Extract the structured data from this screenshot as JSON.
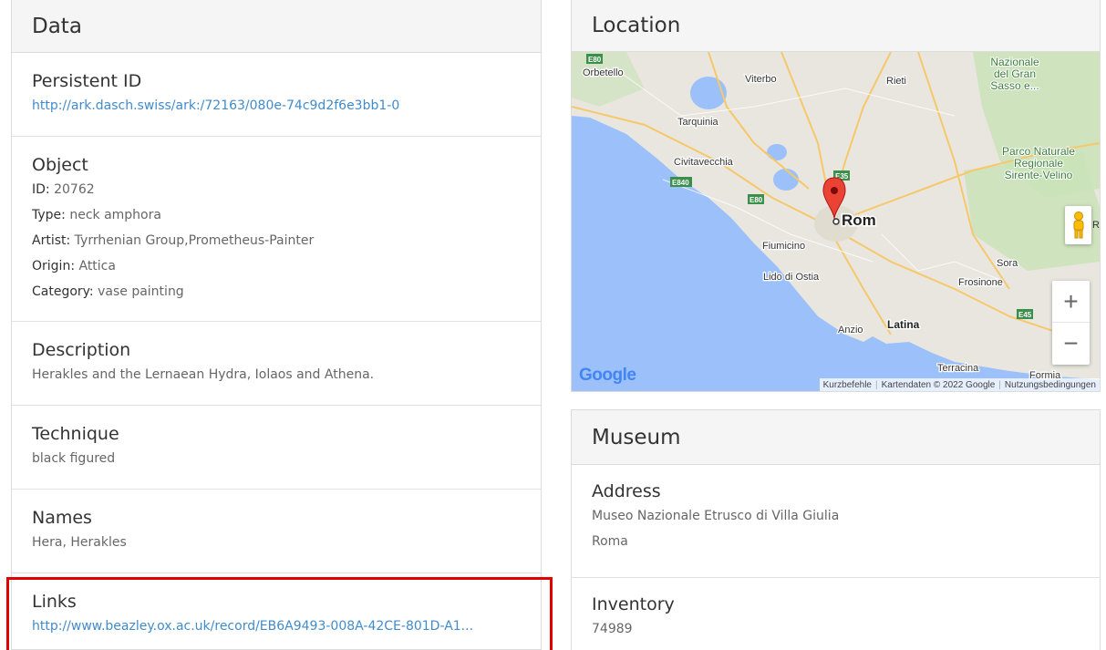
{
  "data_panel": {
    "title": "Data",
    "persistent_id": {
      "heading": "Persistent ID",
      "link": "http://ark.dasch.swiss/ark:/72163/080e-74c9d2f6e3bb1-0"
    },
    "object": {
      "heading": "Object",
      "id_label": "ID:",
      "id_value": "20762",
      "type_label": "Type:",
      "type_value": "neck amphora",
      "artist_label": "Artist:",
      "artist_value": "Tyrrhenian Group,Prometheus-Painter",
      "origin_label": "Origin:",
      "origin_value": "Attica",
      "category_label": "Category:",
      "category_value": "vase painting"
    },
    "description": {
      "heading": "Description",
      "text": "Herakles and the Lernaean Hydra, Iolaos and Athena."
    },
    "technique": {
      "heading": "Technique",
      "text": "black figured"
    },
    "names": {
      "heading": "Names",
      "text": "Hera, Herakles"
    },
    "links": {
      "heading": "Links",
      "link": "http://www.beazley.ox.ac.uk/record/EB6A9493-008A-42CE-801D-A1..."
    }
  },
  "location_panel": {
    "title": "Location",
    "map": {
      "place_labels": {
        "orbetello": "Orbetello",
        "viterbo": "Viterbo",
        "rieti": "Rieti",
        "tarquinia": "Tarquinia",
        "civitavecchia": "Civitavecchia",
        "rom": "Rom",
        "fiumicino": "Fiumicino",
        "lido": "Lido di Ostia",
        "frosinone": "Frosinone",
        "sora": "Sora",
        "anzio": "Anzio",
        "latina": "Latina",
        "terracina": "Terracina",
        "parco1": "Parco Naturale",
        "parco2": "Regionale",
        "parco3": "Sirente-Velino",
        "naz1": "Nazionale",
        "naz2": "del Gran",
        "naz3": "Sasso e...",
        "ro": "Ro",
        "formia": "Formia"
      },
      "road_labels": {
        "e80a": "E80",
        "e35": "E35",
        "e840": "E840",
        "e80b": "E80",
        "e45": "E45"
      },
      "logo": "Google",
      "footer_shortcuts": "Kurzbefehle",
      "footer_data": "Kartendaten © 2022 Google",
      "footer_terms": "Nutzungsbedingungen",
      "zoom_in": "+",
      "zoom_out": "−"
    }
  },
  "museum_panel": {
    "title": "Museum",
    "address": {
      "heading": "Address",
      "line1": "Museo Nazionale Etrusco di Villa Giulia",
      "line2": "Roma"
    },
    "inventory": {
      "heading": "Inventory",
      "value": "74989"
    }
  },
  "colors": {
    "link": "#428bca",
    "highlight": "#e00000",
    "map_marker": "#ea4335",
    "sea": "#9cc0f9",
    "land": "#e8e6df",
    "park": "#c8e2b6"
  }
}
